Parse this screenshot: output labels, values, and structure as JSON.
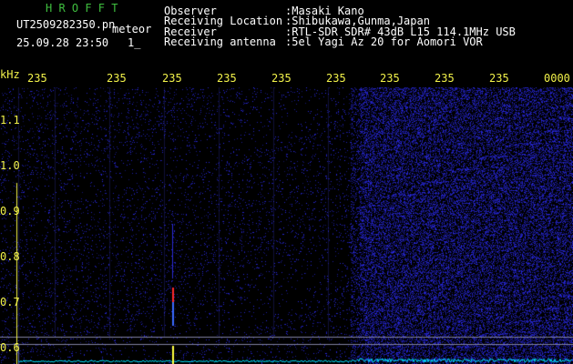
{
  "app": {
    "title": "H R O F F T",
    "file": "UT2509282350.pn",
    "file_suffix": "meteor",
    "timestamp": "25.09.28 23:50",
    "frame": "1_"
  },
  "info": {
    "observer_label": "Observer",
    "observer_value": ":Masaki Kano",
    "location_label": "Receiving Location",
    "location_value": ":Shibukawa,Gunma,Japan",
    "receiver_label": "Receiver",
    "receiver_value": ":RTL-SDR SDR# 43dB L15 114.1MHz USB",
    "antenna_label": "Receiving antenna",
    "antenna_value": ":5el Yagi Az 20 for Aomori VOR"
  },
  "axes": {
    "y_unit": "kHz",
    "y_ticks": [
      "1.1",
      "1.0",
      "0.9",
      "0.8",
      "0.7",
      "0.6"
    ],
    "x_ticks": [
      "235",
      "235",
      "235",
      "235",
      "235",
      "235",
      "235",
      "235",
      "235",
      "0000"
    ]
  },
  "colors": {
    "background": "#000000",
    "title": "#3fbf3f",
    "text": "#ffffff",
    "axis": "#f2f24a",
    "noise": "#2a2ad6",
    "trace": "#00e5ff",
    "meteor": "#ff2a2a"
  }
}
